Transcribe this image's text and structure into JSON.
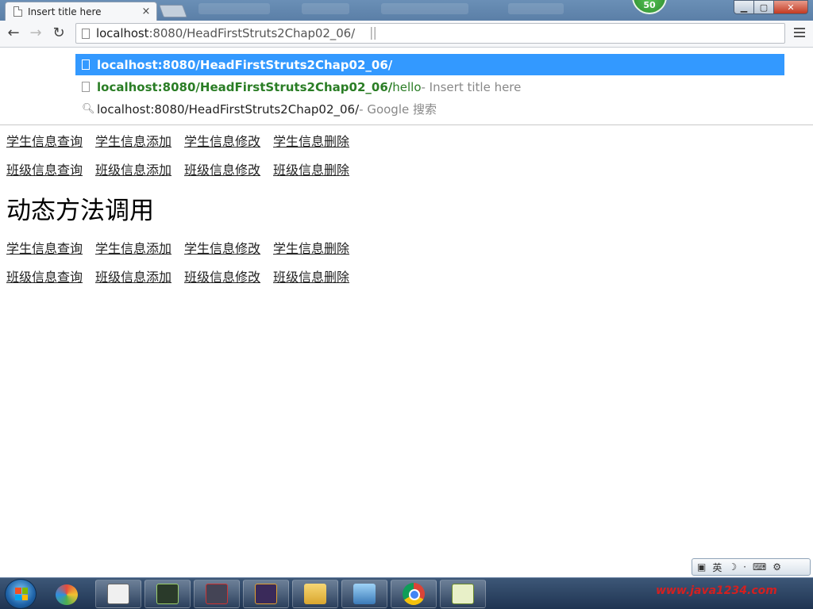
{
  "browser": {
    "tab_title": "Insert title here",
    "tab_close": "×",
    "badge_count": "50",
    "window_buttons": {
      "minimize": "▁",
      "maximize": "▢",
      "close": "✕"
    },
    "url_host": "localhost",
    "url_rest": ":8080/HeadFirstStruts2Chap02_06/"
  },
  "suggestions": [
    {
      "url": "localhost:8080/HeadFirstStruts2Chap02_06/",
      "selected": true
    },
    {
      "url_bold": "localhost:8080/HeadFirstStruts2Chap02_06/",
      "url_suffix": "hello",
      "desc": " - Insert title here"
    },
    {
      "query": "localhost:8080/HeadFirstStruts2Chap02_06/",
      "desc": " - Google 搜索"
    }
  ],
  "page": {
    "rows": [
      [
        "学生信息查询",
        "学生信息添加",
        "学生信息修改",
        "学生信息删除"
      ],
      [
        "班级信息查询",
        "班级信息添加",
        "班级信息修改",
        "班级信息删除"
      ],
      [
        "学生信息查询",
        "学生信息添加",
        "学生信息修改",
        "学生信息删除"
      ],
      [
        "班级信息查询",
        "班级信息添加",
        "班级信息修改",
        "班级信息删除"
      ]
    ],
    "heading": "动态方法调用"
  },
  "langbar": {
    "ime_label": "英"
  },
  "taskbar": {
    "watermark": "www.java1234.com"
  }
}
